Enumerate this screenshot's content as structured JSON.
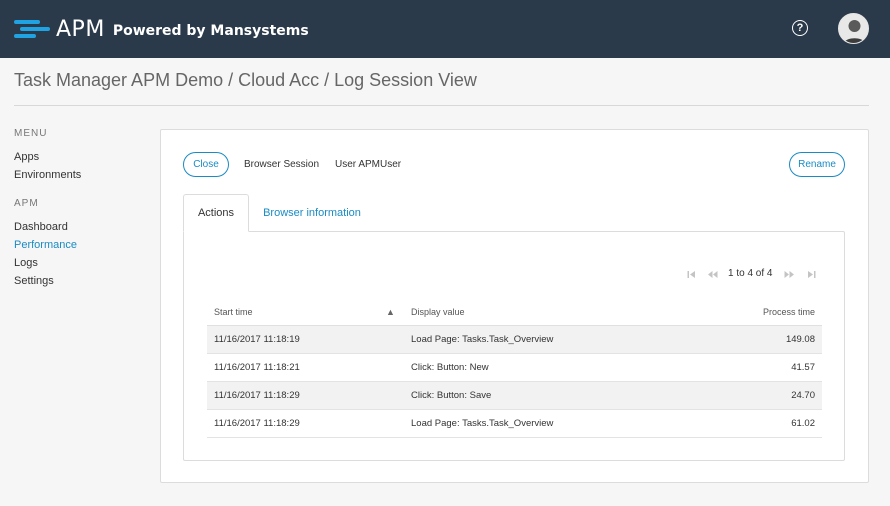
{
  "header": {
    "logo_text": "APM",
    "powered_by": "Powered by Mansystems",
    "help_icon": "question-circle-icon",
    "avatar_icon": "user-avatar-icon",
    "brand_color": "#1fa3e3",
    "bar_color": "#2b3a4a"
  },
  "breadcrumb": {
    "text": "Task Manager APM Demo / Cloud Acc / Log Session View"
  },
  "sidebar": {
    "menu_heading": "MENU",
    "menu_items": [
      "Apps",
      "Environments"
    ],
    "apm_heading": "APM",
    "apm_items": [
      "Dashboard",
      "Performance",
      "Logs",
      "Settings"
    ],
    "active_item": "Performance"
  },
  "toolbar": {
    "close_label": "Close",
    "session_type": "Browser Session",
    "user_label": "User APMUser",
    "rename_label": "Rename"
  },
  "tabs": [
    {
      "label": "Actions",
      "active": true
    },
    {
      "label": "Browser information",
      "active": false
    }
  ],
  "pager": {
    "text": "1 to 4 of 4"
  },
  "grid": {
    "columns": [
      "Start time",
      "Display value",
      "Process time"
    ],
    "sort_indicator": "▲",
    "rows": [
      {
        "start": "11/16/2017 11:18:19",
        "display": "Load Page: Tasks.Task_Overview",
        "process": "149.08"
      },
      {
        "start": "11/16/2017 11:18:21",
        "display": "Click: Button: New",
        "process": "41.57"
      },
      {
        "start": "11/16/2017 11:18:29",
        "display": "Click: Button: Save",
        "process": "24.70"
      },
      {
        "start": "11/16/2017 11:18:29",
        "display": "Load Page: Tasks.Task_Overview",
        "process": "61.02"
      }
    ]
  },
  "accent_color": "#1a8bc4"
}
